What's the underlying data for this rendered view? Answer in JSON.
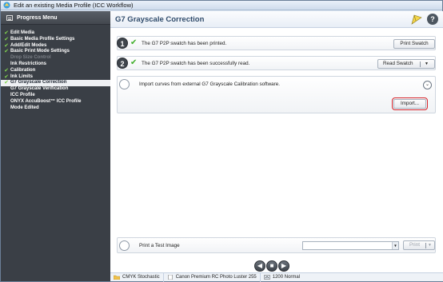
{
  "window": {
    "title": "Edit an existing Media Profile (ICC Workflow)"
  },
  "sidebar": {
    "header": "Progress Menu",
    "items": [
      {
        "label": "Edit Media",
        "checked": true,
        "state": "normal"
      },
      {
        "label": "Basic Media Profile Settings",
        "checked": true,
        "state": "normal"
      },
      {
        "label": "Add/Edit Modes",
        "checked": true,
        "state": "normal"
      },
      {
        "label": "Basic Print Mode Settings",
        "checked": true,
        "state": "normal"
      },
      {
        "label": "Drop Size Control",
        "checked": false,
        "state": "disabled"
      },
      {
        "label": "Ink Restrictions",
        "checked": false,
        "state": "normal"
      },
      {
        "label": "Calibration",
        "checked": true,
        "state": "normal"
      },
      {
        "label": "Ink Limits",
        "checked": true,
        "state": "normal"
      },
      {
        "label": "G7 Grayscale Correction",
        "checked": true,
        "state": "active"
      },
      {
        "label": "G7 Grayscale Verification",
        "checked": false,
        "state": "normal"
      },
      {
        "label": "ICC Profile",
        "checked": false,
        "state": "normal"
      },
      {
        "label": "ONYX AccuBoost™ ICC Profile",
        "checked": false,
        "state": "normal"
      },
      {
        "label": "Mode Edited",
        "checked": false,
        "state": "normal"
      }
    ]
  },
  "main": {
    "title": "G7 Grayscale Correction",
    "steps": [
      {
        "number": "1",
        "text": "The G7 P2P swatch has been printed.",
        "button": "Print Swatch"
      },
      {
        "number": "2",
        "text": "The G7 P2P swatch has been successfully read.",
        "button": "Read Swatch"
      },
      {
        "text": "Import curves from external G7 Grayscale Calibration software.",
        "button": "Import..."
      }
    ],
    "test_print": {
      "text": "Print a Test Image",
      "select_value": "",
      "button": "Print"
    }
  },
  "status": {
    "color_mode": "CMYK Stochastic",
    "media": "Canon Premium RC Photo Luster 255",
    "resolution": "1200 Normal"
  },
  "colors": {
    "sidebar_bg": "#3a3f46",
    "active_item_bg": "#eef0f3",
    "check_green": "#7fd34e",
    "title_blue": "#2f4b6b",
    "highlight_red": "#d6252b"
  }
}
